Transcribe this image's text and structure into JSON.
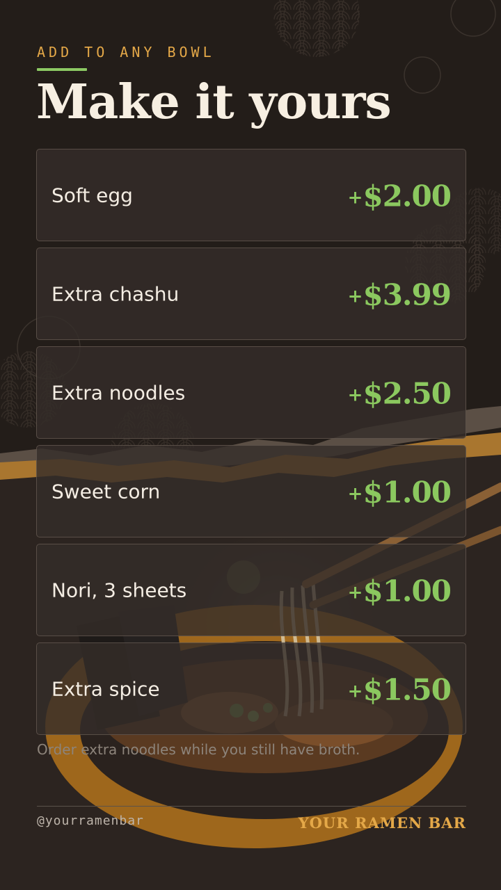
{
  "header": {
    "eyebrow": "ADD TO ANY BOWL",
    "title": "Make it yours"
  },
  "addons": [
    {
      "name": "Soft egg",
      "plus": "+",
      "price": "$2.00"
    },
    {
      "name": "Extra chashu",
      "plus": "+",
      "price": "$3.99"
    },
    {
      "name": "Extra noodles",
      "plus": "+",
      "price": "$2.50"
    },
    {
      "name": "Sweet corn",
      "plus": "+",
      "price": "$1.00"
    },
    {
      "name": "Nori, 3 sheets",
      "plus": "+",
      "price": "$1.00"
    },
    {
      "name": "Extra spice",
      "plus": "+",
      "price": "$1.50"
    }
  ],
  "note": "Order extra noodles while you still have broth.",
  "footer": {
    "handle": "@yourramenbar",
    "brand": "YOUR RAMEN BAR"
  },
  "colors": {
    "background": "#231d19",
    "accent_orange": "#e4a848",
    "accent_green": "#8bc85f",
    "title_cream": "#f7efe2"
  },
  "icons": [
    "ramen-bowl-photo",
    "chopsticks-illustration",
    "seigaiha-wave-pattern"
  ]
}
